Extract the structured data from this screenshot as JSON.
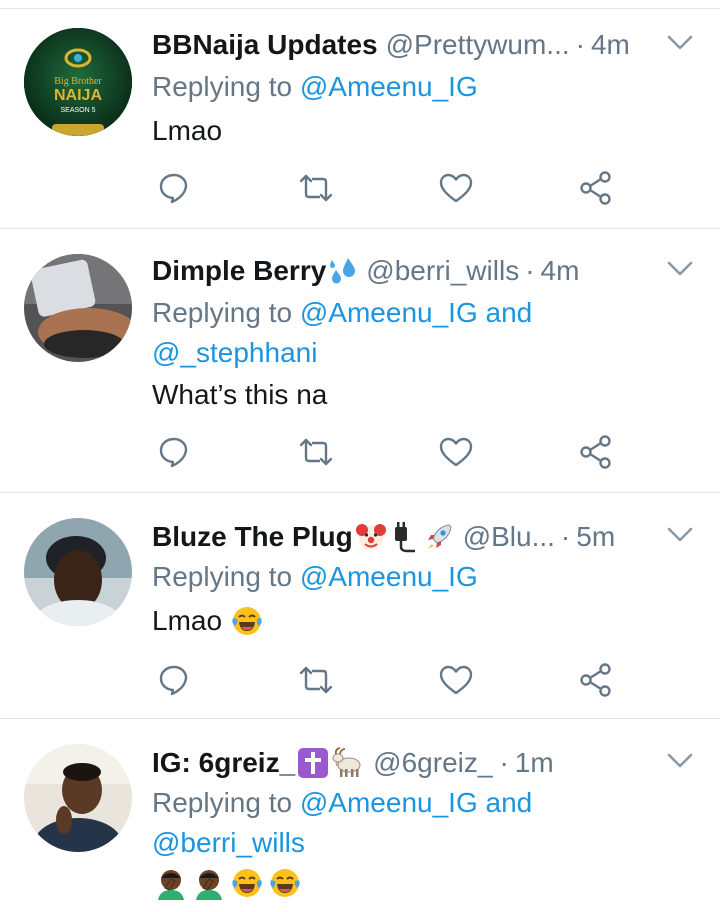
{
  "colors": {
    "link": "#1b95e0",
    "muted": "#657786",
    "divider": "#e1e8ed",
    "text": "#14171a"
  },
  "icons": {
    "reply": "reply-icon",
    "retweet": "retweet-icon",
    "like": "heart-icon",
    "share": "share-icon",
    "more": "chevron-down-icon"
  },
  "tweets": [
    {
      "name": "BBNaija Updates",
      "handle": "@Prettywum...",
      "time": "4m",
      "replying_prefix": "Replying to",
      "mention1": "@Ameenu_IG",
      "text": "Lmao",
      "avatar_text_1": "Big Brother",
      "avatar_text_2": "NAIJA",
      "avatar_text_3": "SEASON 5"
    },
    {
      "name": "Dimple Berry",
      "handle": "@berri_wills",
      "time": "4m",
      "replying_prefix": "Replying to",
      "mention1": "@Ameenu_IG",
      "conj": "and",
      "mention2": "@_stephhani",
      "text": "What’s this na"
    },
    {
      "name": "Bluze The Plug",
      "handle": "@Blu...",
      "time": "5m",
      "replying_prefix": "Replying to",
      "mention1": "@Ameenu_IG",
      "text": "Lmao"
    },
    {
      "name": "IG: 6greiz_",
      "handle": "@6greiz_",
      "time": "1m",
      "replying_prefix": "Replying to",
      "mention1": "@Ameenu_IG",
      "conj": "and",
      "mention2": "@berri_wills"
    }
  ]
}
